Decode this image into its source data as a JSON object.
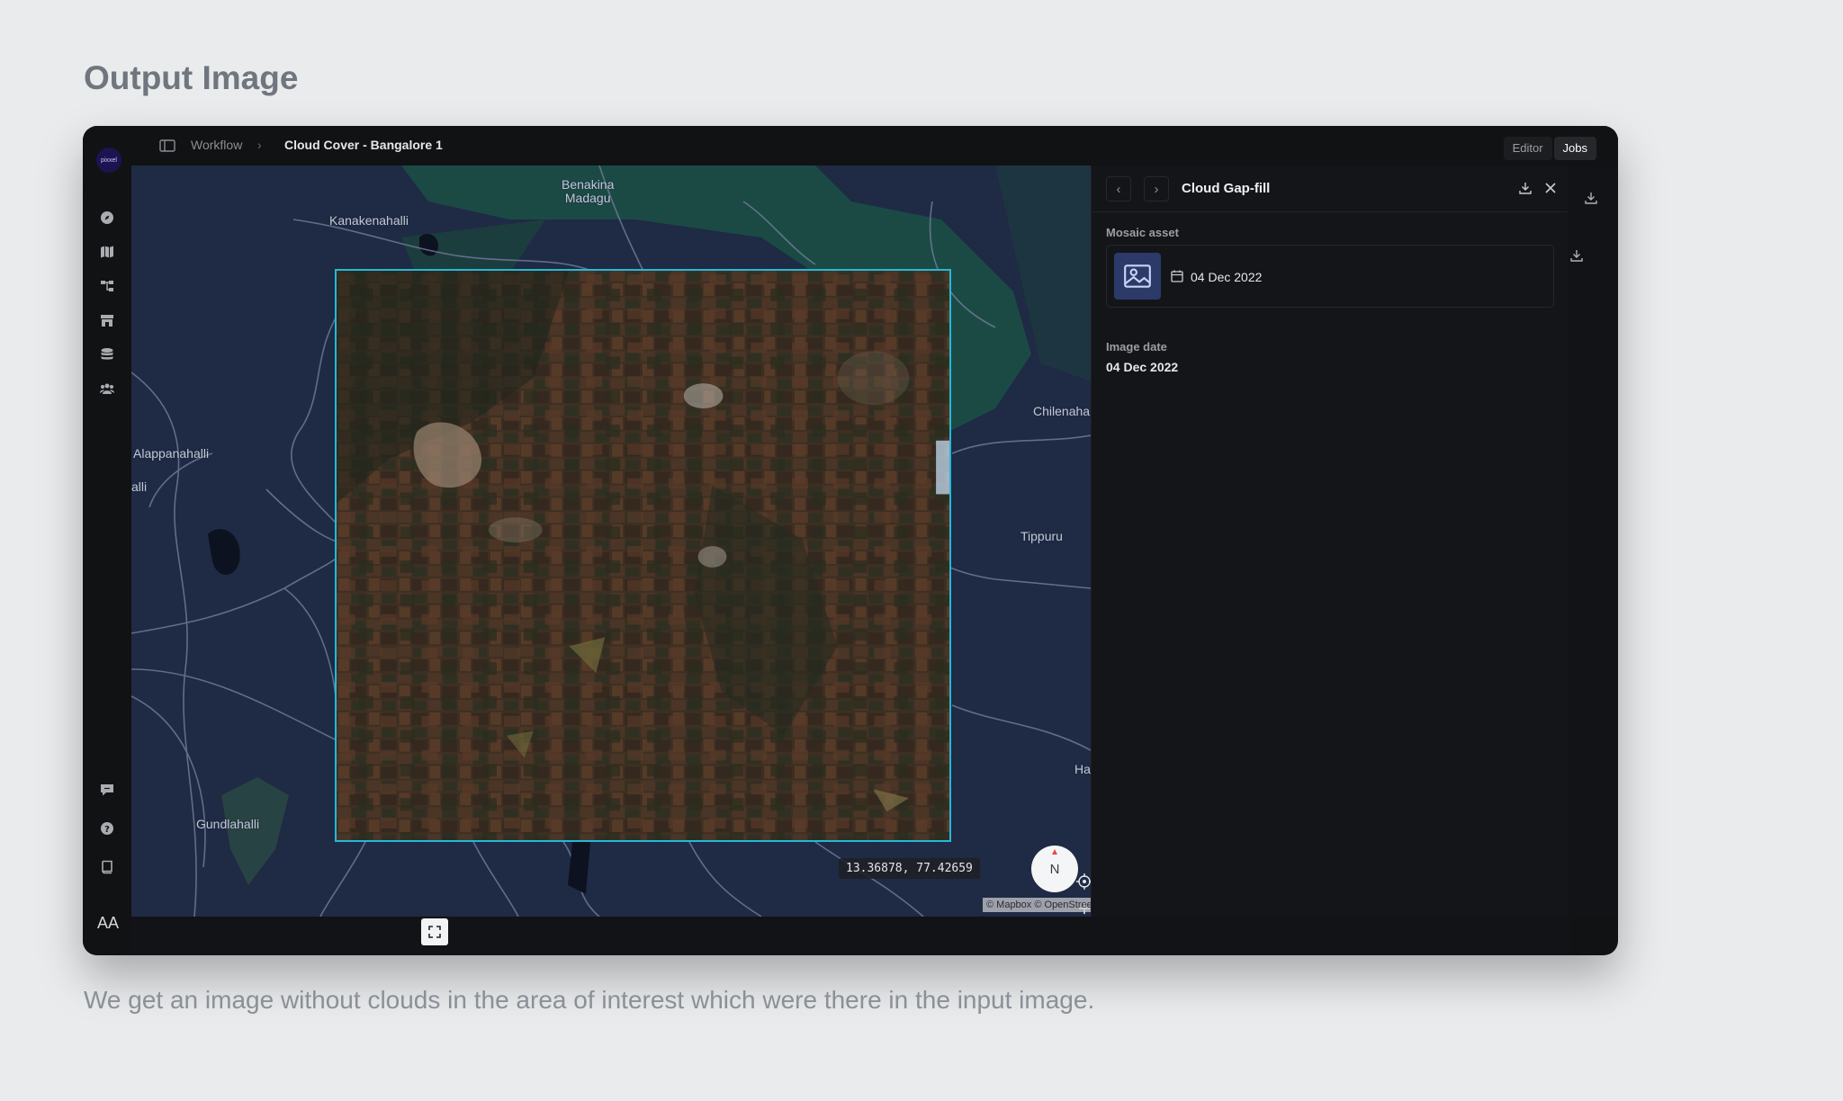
{
  "page": {
    "heading": "Output Image",
    "caption": "We get an image without clouds in the area of interest which were there in the input image."
  },
  "app": {
    "logo_text": "pixxel",
    "avatar_initials": "AA",
    "breadcrumb": {
      "parent": "Workflow",
      "separator": "›",
      "current": "Cloud Cover - Bangalore 1"
    },
    "modes": [
      {
        "label": "Editor",
        "active": false
      },
      {
        "label": "Jobs",
        "active": true
      }
    ],
    "rail_icons": [
      "compass-icon",
      "map-icon",
      "workflow-icon",
      "store-icon",
      "database-icon",
      "team-icon",
      "feedback-icon",
      "help-icon",
      "docs-icon"
    ]
  },
  "map": {
    "places": {
      "benakina": "Benakina\nMadagu",
      "kanakenahalli": "Kanakenahalli",
      "alappanahalli": "Alappanahalli",
      "alli": "alli",
      "chilenaha": "Chilenaha",
      "tippuru": "Tippuru",
      "ha": "Ha",
      "gundlahalli": "Gundlahalli"
    },
    "coordinates": "13.36878, 77.42659",
    "compass_label": "N",
    "attribution": "© Mapbox © OpenStreetMap",
    "aoi_color": "#25b9d8"
  },
  "panel": {
    "nav_prev": "‹",
    "nav_next": "›",
    "title": "Cloud Gap-fill",
    "mosaic_label": "Mosaic asset",
    "mosaic_date": "04 Dec 2022",
    "image_date_label": "Image date",
    "image_date_value": "04 Dec 2022"
  }
}
